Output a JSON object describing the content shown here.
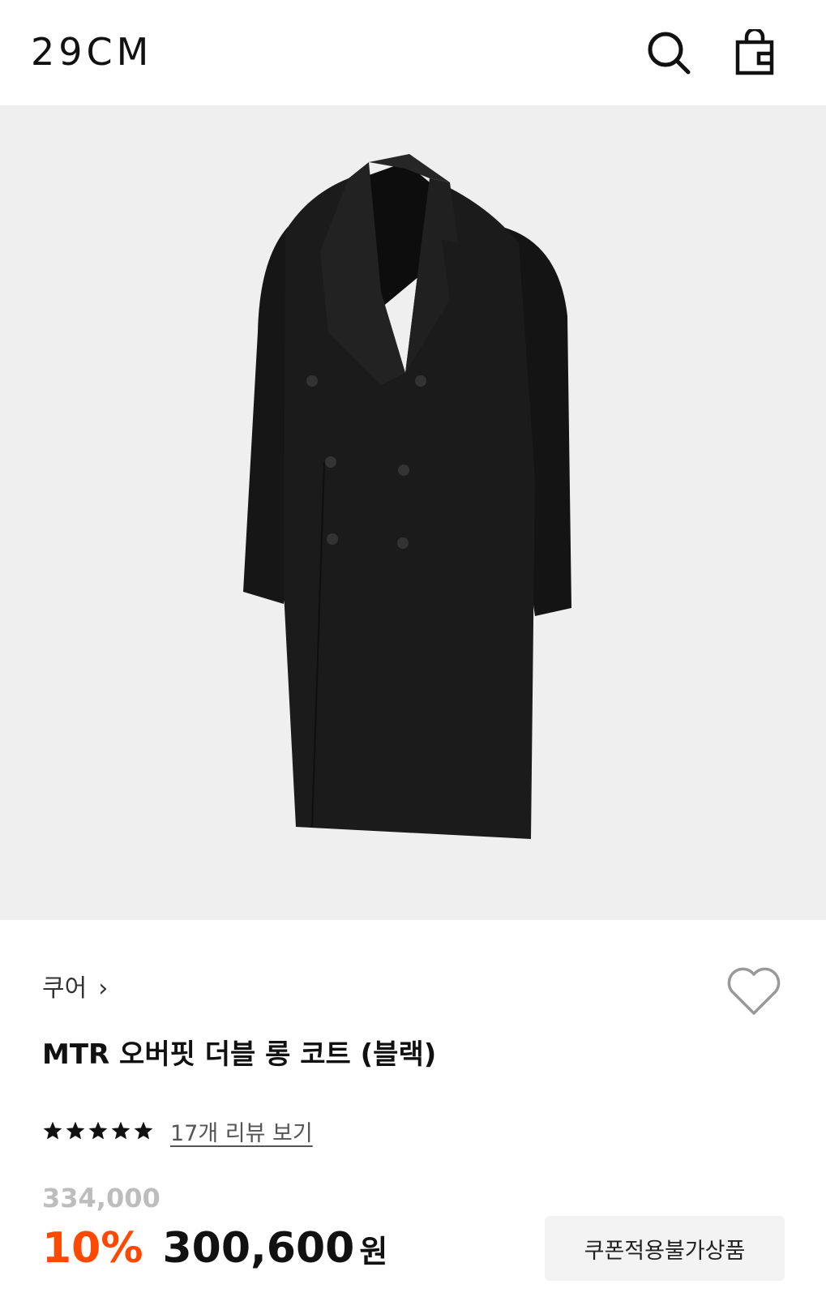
{
  "header": {
    "logo": "29CM",
    "search_icon": "search-icon",
    "bag_icon": "shopping-bag-icon"
  },
  "product": {
    "image_alt": "black double-breasted long coat",
    "brand": "쿠어",
    "brand_chevron": "›",
    "title": "MTR 오버핏 더블 롱 코트 (블랙)",
    "rating_stars": 5,
    "review_link": "17개 리뷰 보기",
    "original_price": "334,000",
    "discount": "10%",
    "sale_price": "300,600",
    "currency": "원",
    "coupon_badge": "쿠폰적용불가상품"
  },
  "colors": {
    "discount": "#ff4800",
    "image_bg": "#efefef",
    "coat": "#1b1b1b"
  }
}
